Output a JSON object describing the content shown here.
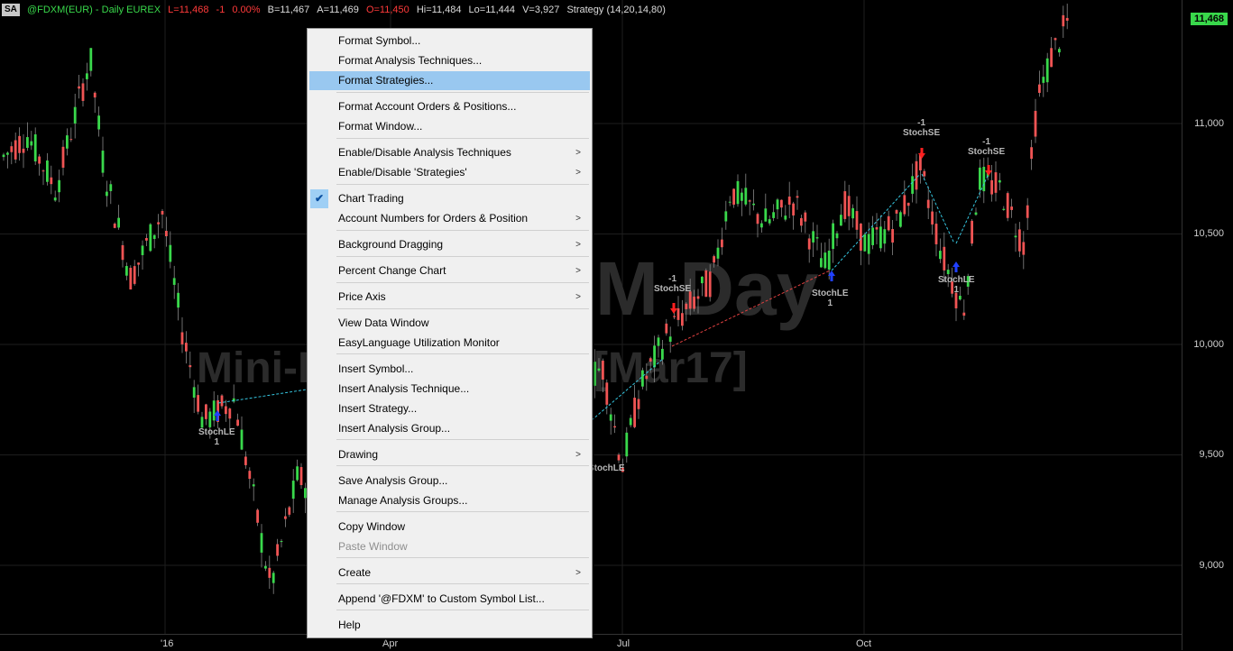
{
  "header": {
    "badge": "SA",
    "symbol": "@FDXM(EUR) - Daily  EUREX",
    "last": "L=11,468",
    "change": "-1",
    "pct": "0.00%",
    "bid": "B=11,467",
    "ask": "A=11,469",
    "open": "O=11,450",
    "high": "Hi=11,484",
    "low": "Lo=11,444",
    "volume": "V=3,927",
    "strategy": "Strategy (14,20,14,80)"
  },
  "watermark": {
    "line1": "M Day",
    "line2": "Mini-D                   us Contract [Mar17]"
  },
  "price_axis": {
    "current": "11,468",
    "ticks": [
      "11,000",
      "10,500",
      "10,000",
      "9,500",
      "9,000"
    ]
  },
  "time_axis": {
    "ticks": [
      "'16",
      "Apr",
      "Jul",
      "Oct"
    ]
  },
  "signals": [
    {
      "name": "StochLE",
      "qty": "1"
    },
    {
      "name": "StochSE",
      "qty": "-1"
    },
    {
      "name": "StochLE",
      "qty": "1"
    },
    {
      "name": "StochSE",
      "qty": "-1"
    },
    {
      "name": "StochSE",
      "qty": "-1"
    },
    {
      "name": "StochLE",
      "qty": "1"
    },
    {
      "name": "StochLE",
      "qty": ""
    }
  ],
  "menu": {
    "items": [
      {
        "label": "Format Symbol...",
        "submenu": false
      },
      {
        "label": "Format Analysis Techniques...",
        "submenu": false
      },
      {
        "label": "Format Strategies...",
        "submenu": false,
        "highlighted": true
      },
      {
        "label": "Format Account Orders & Positions...",
        "submenu": false
      },
      {
        "label": "Format Window...",
        "submenu": false
      },
      {
        "label": "Enable/Disable Analysis Techniques",
        "submenu": true
      },
      {
        "label": "Enable/Disable 'Strategies'",
        "submenu": true
      },
      {
        "label": "Chart Trading",
        "submenu": false,
        "checked": true
      },
      {
        "label": "Account Numbers for Orders & Position",
        "submenu": true
      },
      {
        "label": "Background Dragging",
        "submenu": true
      },
      {
        "label": "Percent Change Chart",
        "submenu": true
      },
      {
        "label": "Price Axis",
        "submenu": true
      },
      {
        "label": "View Data Window",
        "submenu": false
      },
      {
        "label": "EasyLanguage Utilization Monitor",
        "submenu": false
      },
      {
        "label": "Insert Symbol...",
        "submenu": false
      },
      {
        "label": "Insert Analysis Technique...",
        "submenu": false
      },
      {
        "label": "Insert Strategy...",
        "submenu": false
      },
      {
        "label": "Insert Analysis Group...",
        "submenu": false
      },
      {
        "label": "Drawing",
        "submenu": true
      },
      {
        "label": "Save Analysis Group...",
        "submenu": false
      },
      {
        "label": "Manage Analysis Groups...",
        "submenu": false
      },
      {
        "label": "Copy Window",
        "submenu": false
      },
      {
        "label": "Paste Window",
        "submenu": false,
        "disabled": true
      },
      {
        "label": "Create",
        "submenu": true
      },
      {
        "label": "Append '@FDXM' to Custom Symbol List...",
        "submenu": false
      },
      {
        "label": "Help",
        "submenu": false
      }
    ],
    "arrow_glyph": ">",
    "check_glyph": "✔"
  },
  "colors": {
    "up_bar": "#39d84b",
    "down_bar": "#f05454",
    "background": "#000000",
    "menu_highlight": "#99c8f0",
    "entry_arrow": "#2040ff",
    "exit_arrow": "#ff2020"
  }
}
